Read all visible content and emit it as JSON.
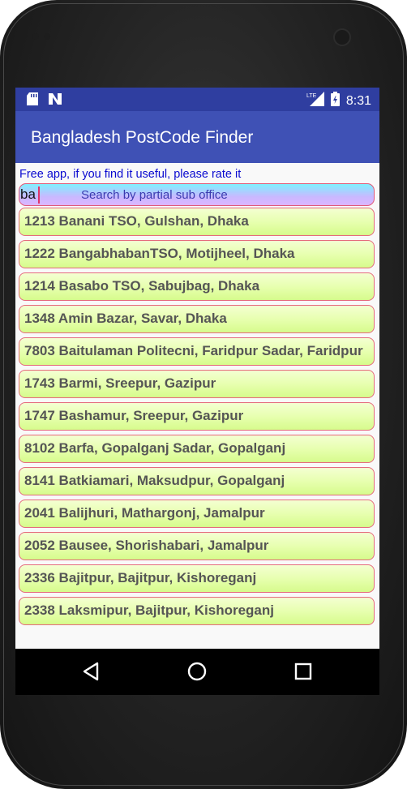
{
  "status_bar": {
    "time": "8:31",
    "left_icons": [
      "sd-card-icon",
      "n-notification-icon"
    ],
    "right_icons": [
      "lte-signal-icon",
      "battery-icon"
    ],
    "network_label": "LTE"
  },
  "app_bar": {
    "title": "Bangladesh PostCode Finder"
  },
  "hint_text": "Free app, if you find it useful, please rate it",
  "search": {
    "value": "ba",
    "placeholder": "Search by partial sub office"
  },
  "results": [
    "1213 Banani TSO, Gulshan, Dhaka",
    "1222 BangabhabanTSO, Motijheel, Dhaka",
    "1214 Basabo TSO, Sabujbag, Dhaka",
    "1348 Amin Bazar, Savar, Dhaka",
    "7803 Baitulaman Politecni, Faridpur Sadar, Faridpur",
    "1743 Barmi, Sreepur, Gazipur",
    "1747 Bashamur, Sreepur, Gazipur",
    "8102 Barfa, Gopalganj Sadar, Gopalganj",
    "8141 Batkiamari, Maksudpur, Gopalganj",
    "2041 Balijhuri, Mathargonj, Jamalpur",
    "2052 Bausee, Shorishabari, Jamalpur",
    "2336 Bajitpur, Bajitpur, Kishoreganj",
    "2338 Laksmipur, Bajitpur, Kishoreganj"
  ],
  "nav_bar": {
    "buttons": [
      "back-icon",
      "home-icon",
      "recents-icon"
    ]
  },
  "colors": {
    "status_bar": "#2f3ea0",
    "app_bar": "#3f51b5",
    "hint_text": "#0a0ad0",
    "item_border": "#e56b7d",
    "item_text": "#555555"
  }
}
